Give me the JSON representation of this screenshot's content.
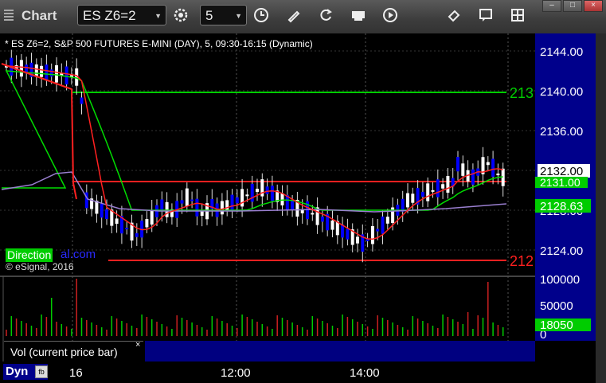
{
  "window": {
    "title": "Chart",
    "symbol_value": "ES Z6=2",
    "interval_value": "5",
    "dropdown_arrow": "▼"
  },
  "toolbar": {
    "icons": [
      "settings-gear-icon",
      "clock-icon",
      "pencil-icon",
      "refresh-icon",
      "get-icon",
      "play-icon",
      "eraser-icon",
      "chat-icon",
      "grid-icon"
    ]
  },
  "chart": {
    "info_line": "* ES Z6=2, S&P 500 FUTURES E-MINI (DAY), 5, 09:30-16:15 (Dynamic)",
    "watermark_box": "Direction",
    "watermark_text": "al.com",
    "copyright": "© eSignal, 2016",
    "price_labels": [
      "2144.00",
      "2140.00",
      "2136.00",
      "2132.00",
      "2128.00",
      "2124.00"
    ],
    "last_price": "2132.00",
    "green_line_label": "2131.00",
    "ma_label": "2128.63",
    "level_top_label": "213",
    "level_bottom_label": "212",
    "volume_axis": [
      "100000",
      "50000",
      "0"
    ],
    "volume_value": "18050",
    "volume_study_label": "Vol (current price bar)",
    "close_symbol": "×",
    "dyn_label": "Dyn",
    "dyn_icon": "fb",
    "time_labels": [
      "16",
      "12:00",
      "14:00"
    ]
  },
  "colors": {
    "up_candle": "#ffffff",
    "down_candle": "#0000ff",
    "red_ma": "#ff2020",
    "green_ma": "#00dd00",
    "purple_ma": "#9a7fd0",
    "level_green": "#00cc00",
    "level_red": "#ff2020",
    "price_axis_bg": "#00008b"
  }
}
